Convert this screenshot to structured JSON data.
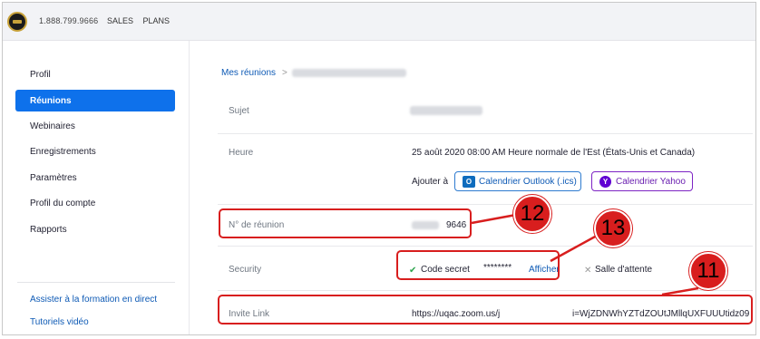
{
  "topbar": {
    "phone": "1.888.799.9666",
    "nav": [
      "SALES",
      "PLANS"
    ]
  },
  "sidebar": {
    "items": [
      {
        "label": "Profil"
      },
      {
        "label": "Réunions",
        "active": true
      },
      {
        "label": "Webinaires"
      },
      {
        "label": "Enregistrements"
      },
      {
        "label": "Paramètres"
      },
      {
        "label": "Profil du compte"
      },
      {
        "label": "Rapports"
      }
    ],
    "links": [
      "Assister à la formation en direct",
      "Tutoriels vidéo"
    ]
  },
  "main": {
    "breadcrumb": {
      "root": "Mes réunions",
      "separator": ">"
    },
    "rows": {
      "subject_label": "Sujet",
      "time_label": "Heure",
      "time_value": "25 août 2020 08:00 AM Heure normale de l'Est (États-Unis et Canada)",
      "add_to_label": "Ajouter à",
      "outlook_button": "Calendrier Outlook (.ics)",
      "yahoo_button": "Calendrier Yahoo",
      "meeting_id_label": "N° de réunion",
      "meeting_id_value": "9646",
      "security_label": "Security",
      "passcode_label": "Code secret",
      "passcode_value": "********",
      "show_link": "Afficher",
      "waiting_room_label": "Salle d'attente",
      "invite_label": "Invite Link",
      "invite_value_start": "https://uqac.zoom.us/j",
      "invite_value_end": "i=WjZDNWhYZTdZOUtJMllqUXFUUUtidz09"
    }
  },
  "annotations": {
    "callouts": [
      "12",
      "13",
      "11"
    ],
    "color": "#d81e1e"
  },
  "colors": {
    "accent": "#0e71eb",
    "outlook": "#0f6cbd",
    "yahoo": "#6001d2"
  }
}
